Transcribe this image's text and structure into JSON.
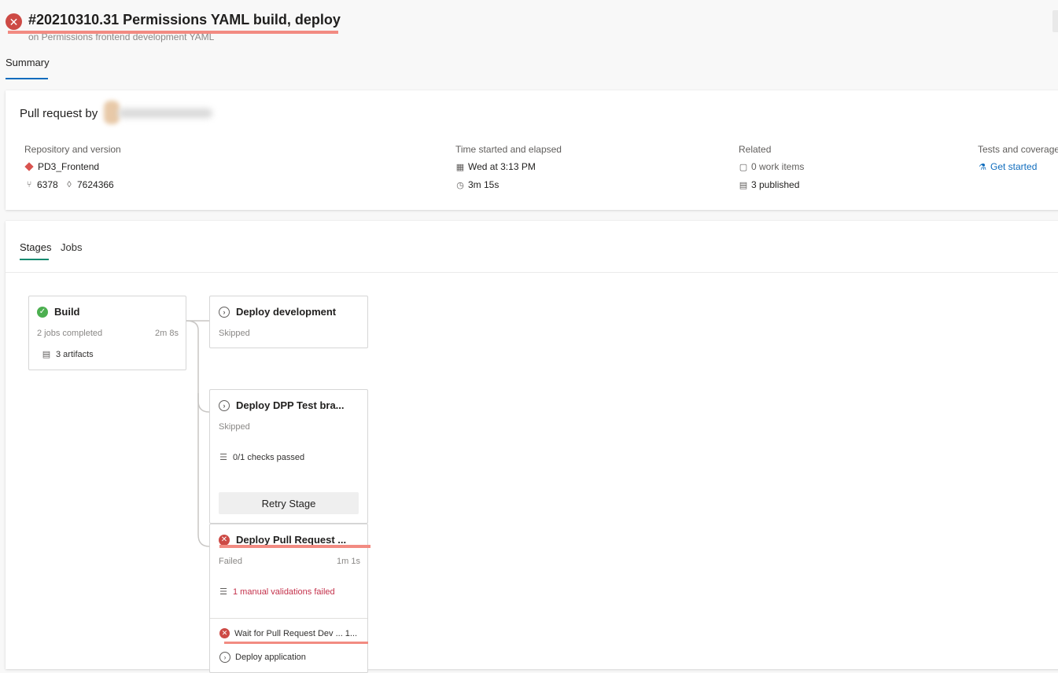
{
  "header": {
    "title": "#20210310.31 Permissions YAML build, deploy",
    "subtitle": "on Permissions frontend development YAML"
  },
  "tabs": {
    "summary": "Summary"
  },
  "summary_card": {
    "pull_request_label": "Pull request by",
    "repository": {
      "label": "Repository and version",
      "repo_name": "PD3_Frontend",
      "pr_number": "6378",
      "commit": "7624366"
    },
    "time": {
      "label": "Time started and elapsed",
      "started": "Wed at 3:13 PM",
      "elapsed": "3m 15s"
    },
    "related": {
      "label": "Related",
      "work_items": "0 work items",
      "published": "3 published"
    },
    "tests": {
      "label": "Tests and coverage",
      "link": "Get started"
    }
  },
  "stages_tabs": {
    "stages": "Stages",
    "jobs": "Jobs"
  },
  "stages": {
    "build": {
      "title": "Build",
      "meta": "2 jobs completed",
      "duration": "2m 8s",
      "artifacts": "3 artifacts",
      "status": "succeeded"
    },
    "deploy_dev": {
      "title": "Deploy development",
      "status_text": "Skipped"
    },
    "deploy_dpp": {
      "title": "Deploy DPP Test bra...",
      "status_text": "Skipped",
      "checks": "0/1 checks passed",
      "retry": "Retry Stage"
    },
    "deploy_pr": {
      "title": "Deploy Pull Request ...",
      "status_text": "Failed",
      "duration": "1m 1s",
      "validation": "1 manual validations failed",
      "jobs": [
        {
          "label": "Wait for Pull Request Dev ... 1...",
          "status": "failed"
        },
        {
          "label": "Deploy application",
          "status": "skipped"
        }
      ]
    }
  },
  "colors": {
    "failed": "#cd4a45",
    "succeeded": "#4caf50",
    "link": "#0f6cbd",
    "highlight": "#f28b82"
  },
  "icons": {
    "header_status": "error-circle-icon",
    "repo": "git-repo-icon",
    "pull_request": "pull-request-icon",
    "commit": "commit-icon",
    "calendar": "calendar-icon",
    "clock": "clock-icon",
    "work_items": "clipboard-icon",
    "published": "artifact-icon",
    "tests": "beaker-icon",
    "checks": "checklist-icon"
  }
}
